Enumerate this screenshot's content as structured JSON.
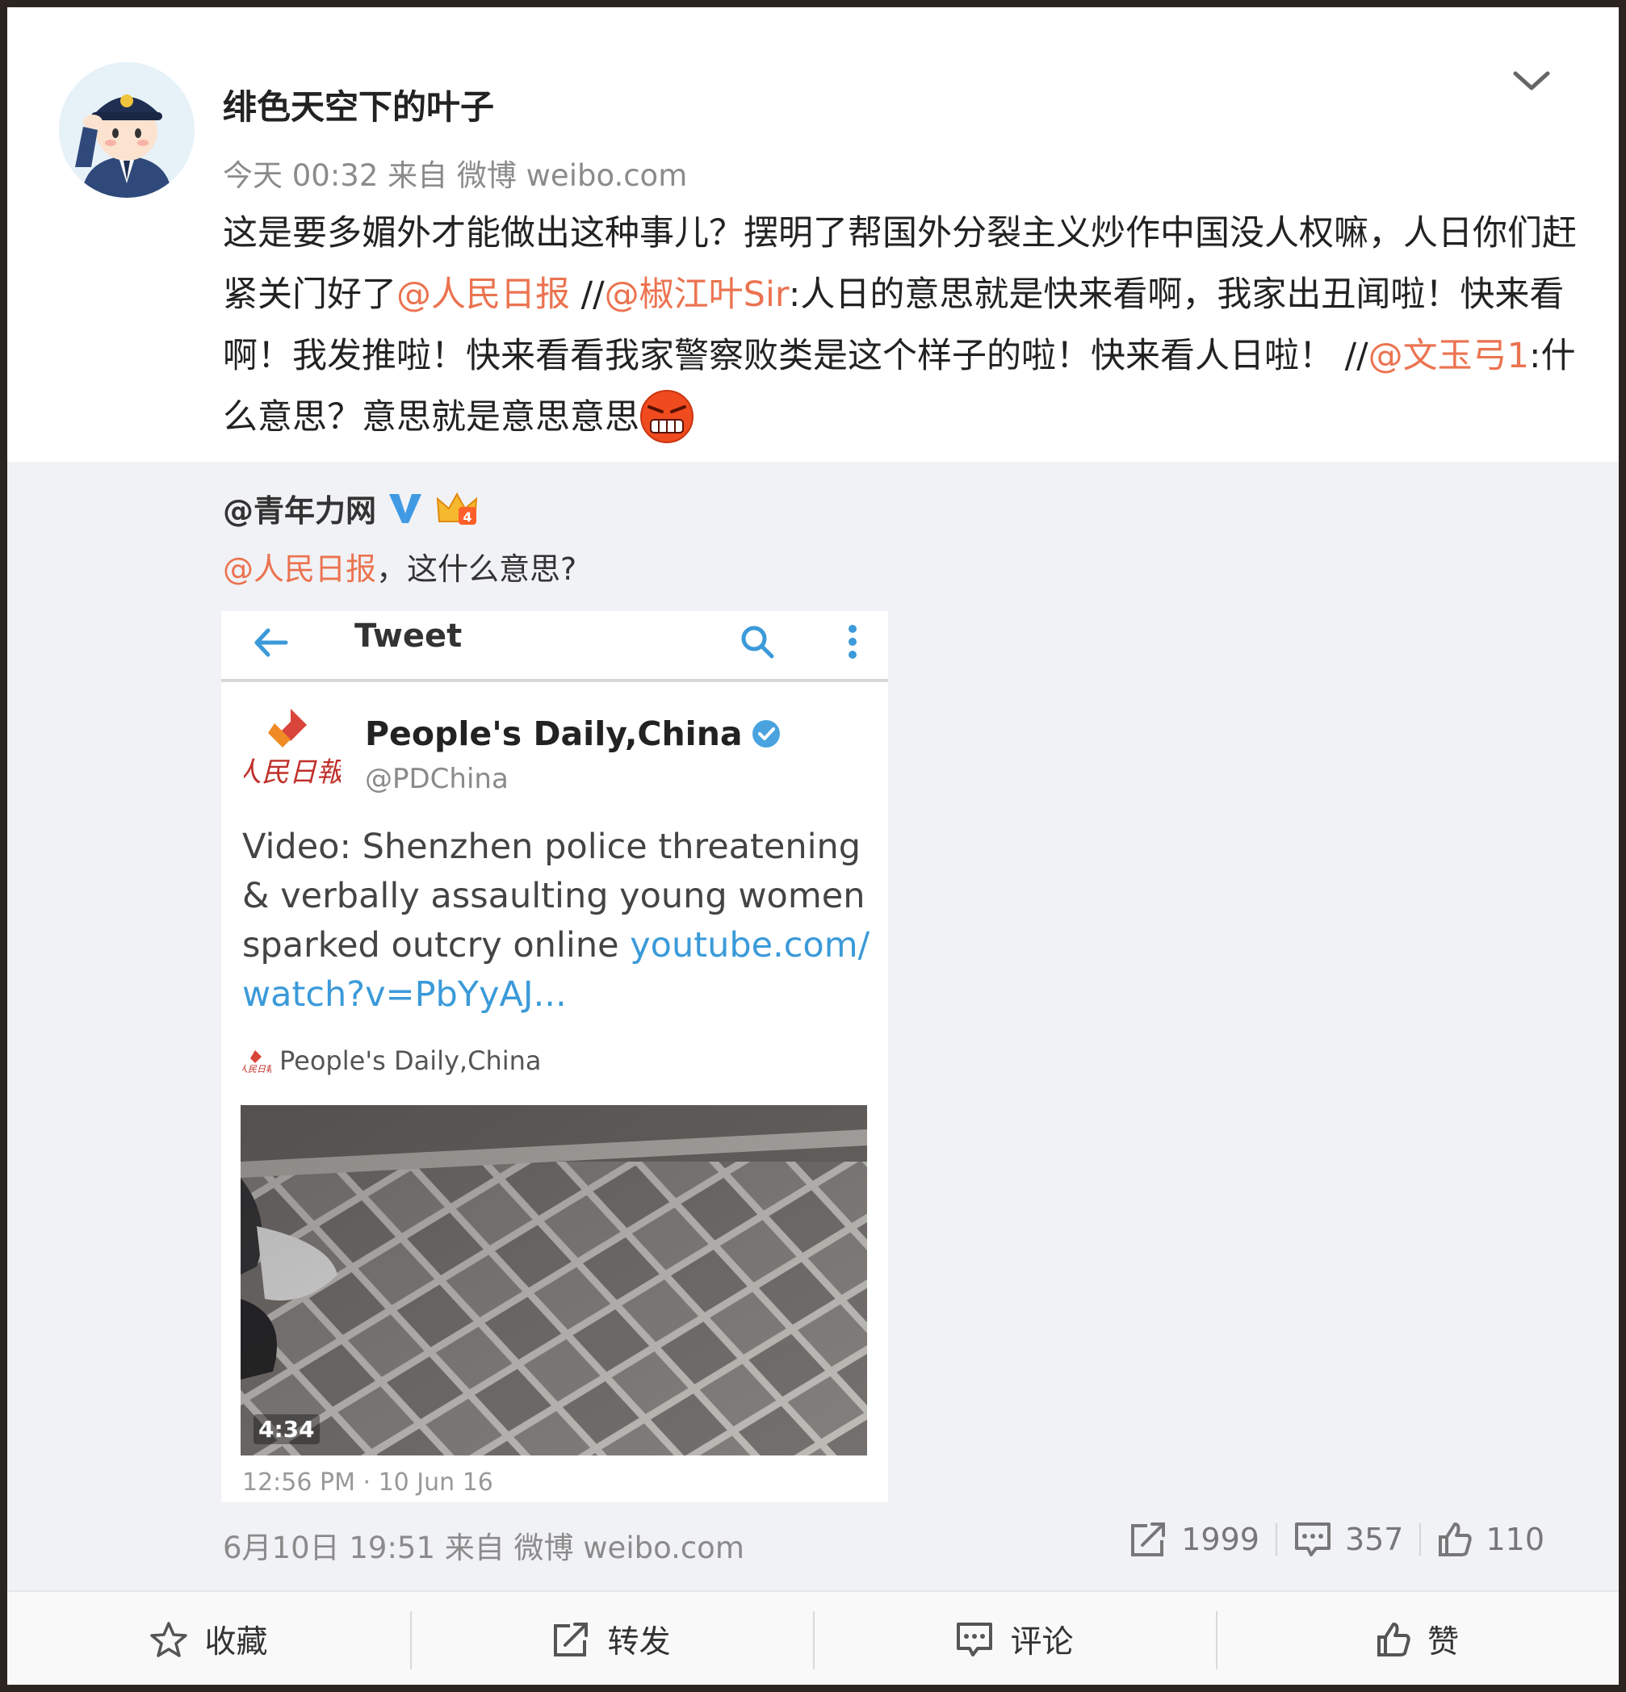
{
  "post": {
    "username": "绯色天空下的叶子",
    "meta": "今天 00:32 来自 微博 weibo.com",
    "content": {
      "p1": "这是要多媚外才能做出这种事儿？摆明了帮国外分裂主义炒作中国没人权嘛，人日你们赶紧关门好了",
      "mention1": "@人民日报",
      "sep1": " //",
      "mention2": "@椒江叶Sir",
      "p2": ":人日的意思就是快来看啊，我家出丑闻啦！快来看啊！我发推啦！快来看看我家警察败类是这个样子的啦！快来看人日啦！",
      "sep2": " //",
      "mention3": "@文玉弓1",
      "p3": ":什么意思？意思就是意思意思"
    }
  },
  "repost": {
    "author": "@青年力网",
    "mention": "@人民日报",
    "text": "，这什么意思?",
    "meta": "6月10日 19:51 来自 微博 weibo.com",
    "stats": {
      "forward": "1999",
      "comment": "357",
      "like": "110"
    }
  },
  "tweet": {
    "bar_title": "Tweet",
    "name": "People's Daily,China",
    "handle": "@PDChina",
    "body": "Video: Shenzhen police threatening & verbally assaulting young women sparked outcry online ",
    "link": "youtube.com/ watch?v=PbYyAJ...",
    "source": "People's Daily,China",
    "duration": "4:34",
    "timestamp": "12:56 PM · 10 Jun 16",
    "logo_text": "人民日報"
  },
  "actions": {
    "favorite": "收藏",
    "forward": "转发",
    "comment": "评论",
    "like": "赞"
  },
  "colors": {
    "mention": "#eb7350",
    "repost_bg": "#f1f2f5",
    "link": "#3b9ad9",
    "verified": "#3f9ae3"
  }
}
